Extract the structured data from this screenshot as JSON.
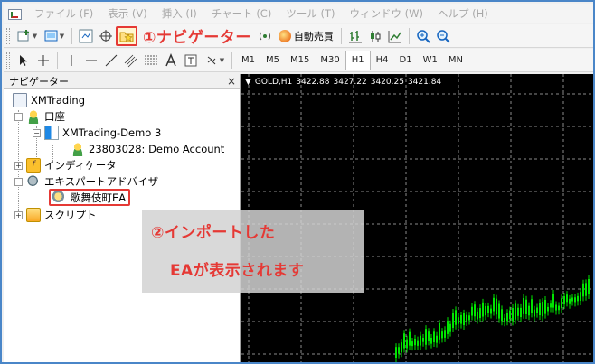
{
  "menu": {
    "items": [
      "ファイル (F)",
      "表示 (V)",
      "挿入 (I)",
      "チャート (C)",
      "ツール (T)",
      "ウィンドウ (W)",
      "ヘルプ (H)"
    ]
  },
  "toolbar": {
    "autotrade_label": "自動売買",
    "annotation_label": "①ナビゲーター"
  },
  "timeframes": [
    "M1",
    "M5",
    "M15",
    "M30",
    "H1",
    "H4",
    "D1",
    "W1",
    "MN"
  ],
  "active_timeframe": "H1",
  "navigator": {
    "title": "ナビゲーター",
    "close": "×",
    "root": "XMTrading",
    "accounts": "口座",
    "server": "XMTrading-Demo 3",
    "account": "23803028: Demo Account",
    "indicators": "インディケータ",
    "experts": "エキスパートアドバイザ",
    "ea_name": "歌舞伎町EA",
    "scripts": "スクリプト"
  },
  "chart": {
    "symbol": "GOLD,H1",
    "ohlc": [
      "3422.88",
      "3427.22",
      "3420.25",
      "3421.84"
    ],
    "colors": {
      "background": "#000000",
      "bull": "#00e600",
      "grid": "#8a8a8a"
    }
  },
  "annotations": {
    "line1": "②インポートした",
    "line2": "EAが表示されます",
    "color": "#e53935"
  }
}
